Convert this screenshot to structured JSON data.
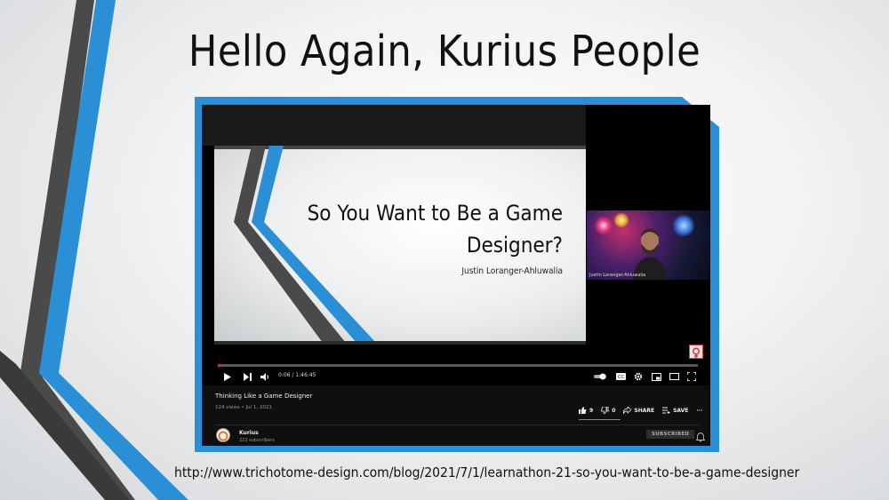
{
  "slide": {
    "title": "Hello Again, Kurius People",
    "url": "http://www.trichotome-design.com/blog/2021/7/1/learnathon-21-so-you-want-to-be-a-game-designer"
  },
  "video": {
    "inner_slide_title_line1": "So You Want to Be a Game",
    "inner_slide_title_line2": "Designer?",
    "inner_slide_author": "Justin Loranger-Ahluwalia",
    "webcam_name": "Justin Loranger-Ahluwalia",
    "time": "0:06 / 1:46:45",
    "progress_fraction": 0.0006,
    "title": "Thinking Like a Game Designer",
    "views": "124 views • Jul 1, 2021",
    "likes": "9",
    "dislikes": "0",
    "share_label": "SHARE",
    "save_label": "SAVE",
    "more_label": "···",
    "channel_name": "Kurius",
    "subscribers": "223 subscribers",
    "subscribed_label": "SUBSCRIBED"
  },
  "colors": {
    "accent_blue": "#2b8fd6",
    "stripe_gray": "#4a4a4a",
    "progress_red": "#e22233"
  },
  "icons": [
    "play-icon",
    "next-icon",
    "volume-icon",
    "autoplay-toggle-icon",
    "captions-icon",
    "settings-icon",
    "miniplayer-icon",
    "theater-icon",
    "fullscreen-icon",
    "thumbs-up-icon",
    "thumbs-down-icon",
    "share-icon",
    "save-icon",
    "bell-icon"
  ]
}
